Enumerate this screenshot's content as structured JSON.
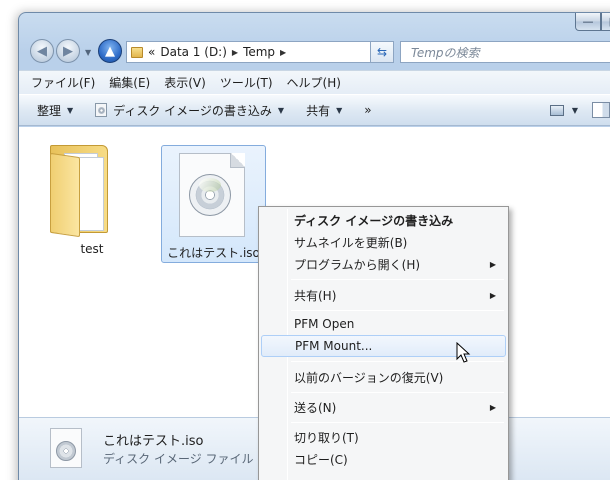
{
  "window": {
    "caption_buttons": [
      "—",
      "□"
    ]
  },
  "nav": {
    "back_icon": "back-arrow-icon",
    "forward_icon": "forward-arrow-icon",
    "up_icon": "up-arrow-icon",
    "address": {
      "overflow": "«",
      "segments": [
        "Data 1 (D:)",
        "Temp"
      ]
    },
    "search_placeholder": "Tempの検索"
  },
  "menu_bar": {
    "items": [
      "ファイル(F)",
      "編集(E)",
      "表示(V)",
      "ツール(T)",
      "ヘルプ(H)"
    ]
  },
  "command_bar": {
    "organize": "整理",
    "burn": "ディスク イメージの書き込み",
    "share": "共有",
    "more": "»"
  },
  "files": [
    {
      "name": "test",
      "type": "folder"
    },
    {
      "name": "これはテスト.iso",
      "type": "disc-image",
      "selected": true
    }
  ],
  "details": {
    "name": "これはテスト.iso",
    "type": "ディスク イメージ ファイル"
  },
  "context_menu": {
    "items": [
      {
        "label": "ディスク イメージの書き込み",
        "bold": true
      },
      {
        "label": "サムネイルを更新(B)"
      },
      {
        "label": "プログラムから開く(H)",
        "submenu": true
      },
      {
        "label": "共有(H)",
        "submenu": true
      },
      {
        "label": "PFM Open"
      },
      {
        "label": "PFM Mount...",
        "hover": true
      },
      {
        "label": "以前のバージョンの復元(V)"
      },
      {
        "label": "送る(N)",
        "submenu": true
      },
      {
        "label": "切り取り(T)"
      },
      {
        "label": "コピー(C)"
      }
    ]
  },
  "colors": {
    "frame": "#bcd2eb",
    "selection": "#d4e7fb",
    "menu_hover": "#e1ecfa"
  }
}
